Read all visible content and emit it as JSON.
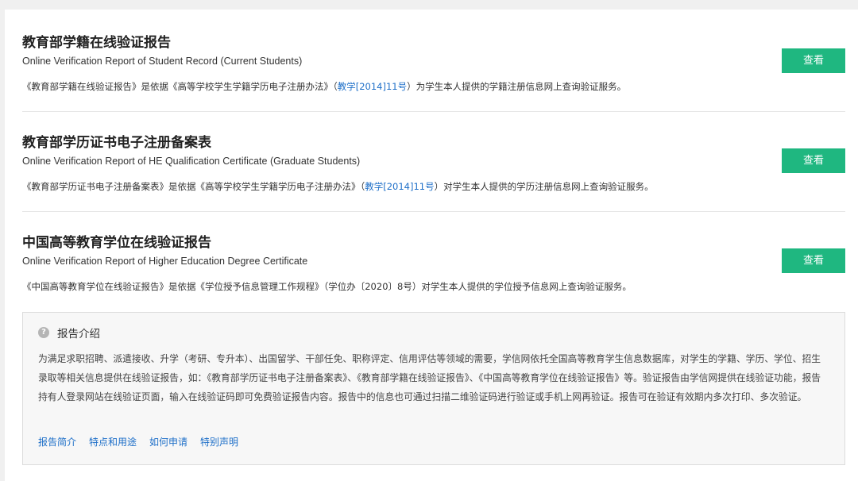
{
  "reports": [
    {
      "title": "教育部学籍在线验证报告",
      "subtitle": "Online Verification Report of Student Record (Current Students)",
      "desc_before": "《教育部学籍在线验证报告》是依据《高等学校学生学籍学历电子注册办法》（",
      "desc_link": "教学[2014]11号",
      "desc_after": "）为学生本人提供的学籍注册信息网上查询验证服务。",
      "button_label": "查看"
    },
    {
      "title": "教育部学历证书电子注册备案表",
      "subtitle": "Online Verification Report of HE Qualification Certificate (Graduate Students)",
      "desc_before": "《教育部学历证书电子注册备案表》是依据《高等学校学生学籍学历电子注册办法》（",
      "desc_link": "教学[2014]11号",
      "desc_after": "）对学生本人提供的学历注册信息网上查询验证服务。",
      "button_label": "查看"
    },
    {
      "title": "中国高等教育学位在线验证报告",
      "subtitle": "Online Verification Report of Higher Education Degree Certificate",
      "desc_before": "《中国高等教育学位在线验证报告》是依据《学位授予信息管理工作规程》（学位办〔2020〕8号）对学生本人提供的学位授予信息网上查询验证服务。",
      "desc_link": "",
      "desc_after": "",
      "button_label": "查看"
    }
  ],
  "intro": {
    "icon": "question-circle-icon",
    "title": "报告介绍",
    "text": "为满足求职招聘、派遣接收、升学（考研、专升本）、出国留学、干部任免、职称评定、信用评估等领域的需要，学信网依托全国高等教育学生信息数据库，对学生的学籍、学历、学位、招生录取等相关信息提供在线验证报告，如：《教育部学历证书电子注册备案表》、《教育部学籍在线验证报告》、《中国高等教育学位在线验证报告》等。验证报告由学信网提供在线验证功能，报告持有人登录网站在线验证页面，输入在线验证码即可免费验证报告内容。报告中的信息也可通过扫描二维验证码进行验证或手机上网再验证。报告可在验证有效期内多次打印、多次验证。",
    "links": [
      "报告简介",
      "特点和用途",
      "如何申请",
      "特别声明"
    ]
  },
  "colors": {
    "button": "#1fb780",
    "link": "#1e6fc8"
  }
}
